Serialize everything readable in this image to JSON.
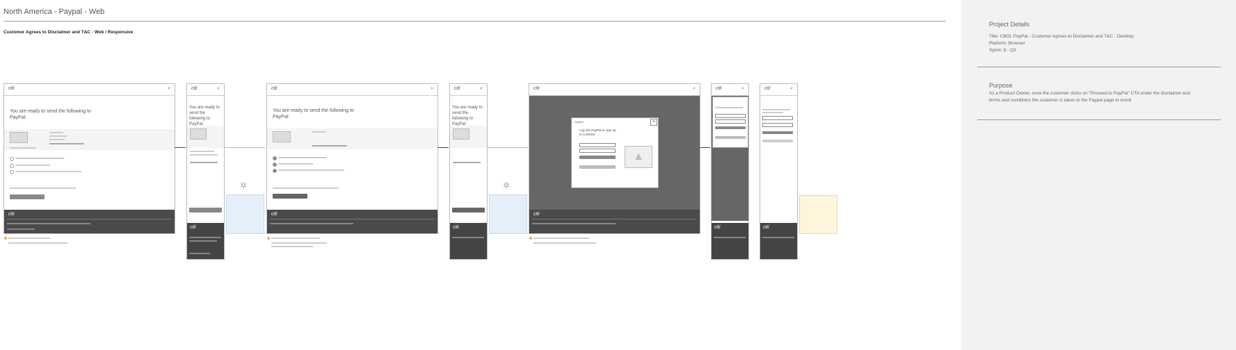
{
  "header": {
    "title": "North America - Paypal - Web",
    "subtitle": "Customer Agrees to Disclaimer and T&C - Web / Responsive"
  },
  "project": {
    "heading": "Project Details",
    "title_line": "Title:   CBOL PayPal - Customer Agrees to Disclaimer and T&C - Desktop",
    "platform_line": "Platform:  Browser",
    "sprint_line": "Sprint: 8 - Q3"
  },
  "purpose": {
    "heading": "Purpose",
    "text": "As a Product Owner, once the customer clicks on \"Proceed to PayPal\" CTA under the disclaimer and terms and conditions the customer is taken to the Paypal page to enroll."
  },
  "screens": {
    "logo": "citi",
    "ready_text": "You are ready to send the following to PayPal:",
    "modal_text": "Log into PayPal or sign up to continue.",
    "paypal_label": "PayPal"
  },
  "icons": {
    "search": "search-icon",
    "spinner": "spinner-icon",
    "close": "close-icon",
    "image": "image-placeholder-icon"
  }
}
